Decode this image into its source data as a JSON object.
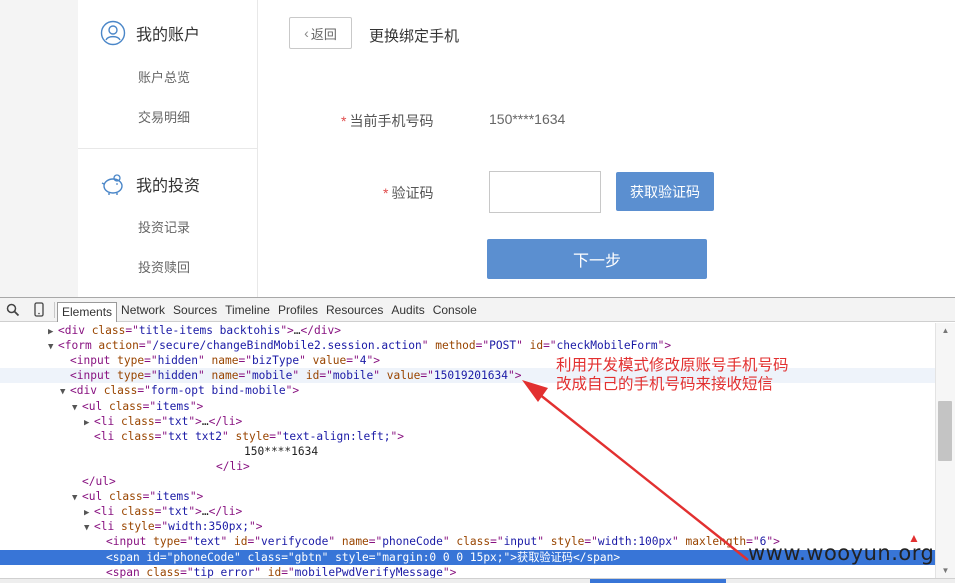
{
  "sidebar": {
    "sections": [
      {
        "title": "我的账户",
        "icon": "user-icon",
        "items": [
          "账户总览",
          "交易明细"
        ]
      },
      {
        "title": "我的投资",
        "icon": "piggy-bank-icon",
        "items": [
          "投资记录",
          "投资赎回"
        ]
      }
    ]
  },
  "main": {
    "back_label": "返回",
    "title": "更换绑定手机",
    "required_mark": "*",
    "current_phone_label": "当前手机号码",
    "current_phone_value": "150****1634",
    "code_label": "验证码",
    "code_value": "",
    "get_code_label": "获取验证码",
    "next_label": "下一步"
  },
  "devtools": {
    "tabs": [
      "Elements",
      "Network",
      "Sources",
      "Timeline",
      "Profiles",
      "Resources",
      "Audits",
      "Console"
    ],
    "active_tab": "Elements",
    "lines": [
      {
        "tri": "▶",
        "parts": [
          [
            "tg",
            "<div "
          ],
          [
            "an",
            "class"
          ],
          [
            "tg",
            "=\""
          ],
          [
            "av",
            "title-items backtohis"
          ],
          [
            "tg",
            "\">"
          ],
          [
            "tx",
            "…"
          ],
          [
            "tg",
            "</div>"
          ]
        ]
      },
      {
        "tri": "▼",
        "parts": [
          [
            "tg",
            "<form "
          ],
          [
            "an",
            "action"
          ],
          [
            "tg",
            "=\""
          ],
          [
            "av",
            "/secure/changeBindMobile2.session.action"
          ],
          [
            "tg",
            "\" "
          ],
          [
            "an",
            "method"
          ],
          [
            "tg",
            "=\""
          ],
          [
            "av",
            "POST"
          ],
          [
            "tg",
            "\" "
          ],
          [
            "an",
            "id"
          ],
          [
            "tg",
            "=\""
          ],
          [
            "av",
            "checkMobileForm"
          ],
          [
            "tg",
            "\">"
          ]
        ]
      },
      {
        "tri": "",
        "parts": [
          [
            "tg",
            "<input "
          ],
          [
            "an",
            "type"
          ],
          [
            "tg",
            "=\""
          ],
          [
            "av",
            "hidden"
          ],
          [
            "tg",
            "\" "
          ],
          [
            "an",
            "name"
          ],
          [
            "tg",
            "=\""
          ],
          [
            "av",
            "bizType"
          ],
          [
            "tg",
            "\" "
          ],
          [
            "an",
            "value"
          ],
          [
            "tg",
            "=\""
          ],
          [
            "av",
            "4"
          ],
          [
            "tg",
            "\">"
          ]
        ]
      },
      {
        "tri": "",
        "parts": [
          [
            "tg",
            "<input "
          ],
          [
            "an",
            "type"
          ],
          [
            "tg",
            "=\""
          ],
          [
            "av",
            "hidden"
          ],
          [
            "tg",
            "\" "
          ],
          [
            "an",
            "name"
          ],
          [
            "tg",
            "=\""
          ],
          [
            "av",
            "mobile"
          ],
          [
            "tg",
            "\" "
          ],
          [
            "an",
            "id"
          ],
          [
            "tg",
            "=\""
          ],
          [
            "av",
            "mobile"
          ],
          [
            "tg",
            "\" "
          ],
          [
            "an",
            "value"
          ],
          [
            "tg",
            "=\""
          ],
          [
            "av",
            "15019201634"
          ],
          [
            "tg",
            "\">"
          ]
        ]
      },
      {
        "tri": "▼",
        "parts": [
          [
            "tg",
            "<div "
          ],
          [
            "an",
            "class"
          ],
          [
            "tg",
            "=\""
          ],
          [
            "av",
            "form-opt bind-mobile"
          ],
          [
            "tg",
            "\">"
          ]
        ]
      },
      {
        "tri": "▼",
        "parts": [
          [
            "tg",
            "<ul "
          ],
          [
            "an",
            "class"
          ],
          [
            "tg",
            "=\""
          ],
          [
            "av",
            "items"
          ],
          [
            "tg",
            "\">"
          ]
        ]
      },
      {
        "tri": "▶",
        "parts": [
          [
            "tg",
            "<li "
          ],
          [
            "an",
            "class"
          ],
          [
            "tg",
            "=\""
          ],
          [
            "av",
            "txt"
          ],
          [
            "tg",
            "\">"
          ],
          [
            "tx",
            "…"
          ],
          [
            "tg",
            "</li>"
          ]
        ]
      },
      {
        "tri": "",
        "parts": [
          [
            "tg",
            "<li "
          ],
          [
            "an",
            "class"
          ],
          [
            "tg",
            "=\""
          ],
          [
            "av",
            "txt txt2"
          ],
          [
            "tg",
            "\" "
          ],
          [
            "an",
            "style"
          ],
          [
            "tg",
            "=\""
          ],
          [
            "av",
            "text-align:left;"
          ],
          [
            "tg",
            "\">"
          ]
        ]
      },
      {
        "tri": "",
        "parts": [
          [
            "tx",
            "150****1634"
          ]
        ]
      },
      {
        "tri": "",
        "parts": [
          [
            "tg",
            "</li>"
          ]
        ]
      },
      {
        "tri": "",
        "parts": [
          [
            "tg",
            "</ul>"
          ]
        ]
      },
      {
        "tri": "▼",
        "parts": [
          [
            "tg",
            "<ul "
          ],
          [
            "an",
            "class"
          ],
          [
            "tg",
            "=\""
          ],
          [
            "av",
            "items"
          ],
          [
            "tg",
            "\">"
          ]
        ]
      },
      {
        "tri": "▶",
        "parts": [
          [
            "tg",
            "<li "
          ],
          [
            "an",
            "class"
          ],
          [
            "tg",
            "=\""
          ],
          [
            "av",
            "txt"
          ],
          [
            "tg",
            "\">"
          ],
          [
            "tx",
            "…"
          ],
          [
            "tg",
            "</li>"
          ]
        ]
      },
      {
        "tri": "▼",
        "parts": [
          [
            "tg",
            "<li "
          ],
          [
            "an",
            "style"
          ],
          [
            "tg",
            "=\""
          ],
          [
            "av",
            "width:350px;"
          ],
          [
            "tg",
            "\">"
          ]
        ]
      },
      {
        "tri": "",
        "parts": [
          [
            "tg",
            "<input "
          ],
          [
            "an",
            "type"
          ],
          [
            "tg",
            "=\""
          ],
          [
            "av",
            "text"
          ],
          [
            "tg",
            "\" "
          ],
          [
            "an",
            "id"
          ],
          [
            "tg",
            "=\""
          ],
          [
            "av",
            "verifycode"
          ],
          [
            "tg",
            "\" "
          ],
          [
            "an",
            "name"
          ],
          [
            "tg",
            "=\""
          ],
          [
            "av",
            "phoneCode"
          ],
          [
            "tg",
            "\" "
          ],
          [
            "an",
            "class"
          ],
          [
            "tg",
            "=\""
          ],
          [
            "av",
            "input"
          ],
          [
            "tg",
            "\" "
          ],
          [
            "an",
            "style"
          ],
          [
            "tg",
            "=\""
          ],
          [
            "av",
            "width:100px"
          ],
          [
            "tg",
            "\" "
          ],
          [
            "an",
            "maxlength"
          ],
          [
            "tg",
            "=\""
          ],
          [
            "av",
            "6"
          ],
          [
            "tg",
            "\">"
          ]
        ]
      },
      {
        "tri": "",
        "parts": [
          [
            "tg",
            "<span "
          ],
          [
            "an",
            "id"
          ],
          [
            "tg",
            "=\""
          ],
          [
            "av",
            "phoneCode"
          ],
          [
            "tg",
            "\" "
          ],
          [
            "an",
            "class"
          ],
          [
            "tg",
            "=\""
          ],
          [
            "av",
            "gbtn"
          ],
          [
            "tg",
            "\" "
          ],
          [
            "an",
            "style"
          ],
          [
            "tg",
            "=\""
          ],
          [
            "av",
            "margin:0 0 0 15px;"
          ],
          [
            "tg",
            "\">"
          ],
          [
            "tx",
            "获取验证码"
          ],
          [
            "tg",
            "</span>"
          ]
        ]
      },
      {
        "tri": "",
        "parts": [
          [
            "tg",
            "<span "
          ],
          [
            "an",
            "class"
          ],
          [
            "tg",
            "=\""
          ],
          [
            "av",
            "tip error"
          ],
          [
            "tg",
            "\" "
          ],
          [
            "an",
            "id"
          ],
          [
            "tg",
            "=\""
          ],
          [
            "av",
            "mobilePwdVerifyMessage"
          ],
          [
            "tg",
            "\">"
          ]
        ]
      }
    ]
  },
  "annotation": {
    "line1": "利用开发模式修改原账号手机号码",
    "line2": "改成自己的手机号码来接收短信",
    "marker": "▲"
  },
  "watermark": "www.wooyun.org",
  "colors": {
    "accent": "#5b8fd0",
    "annotation": "#e23030",
    "selection": "#3875d7"
  }
}
